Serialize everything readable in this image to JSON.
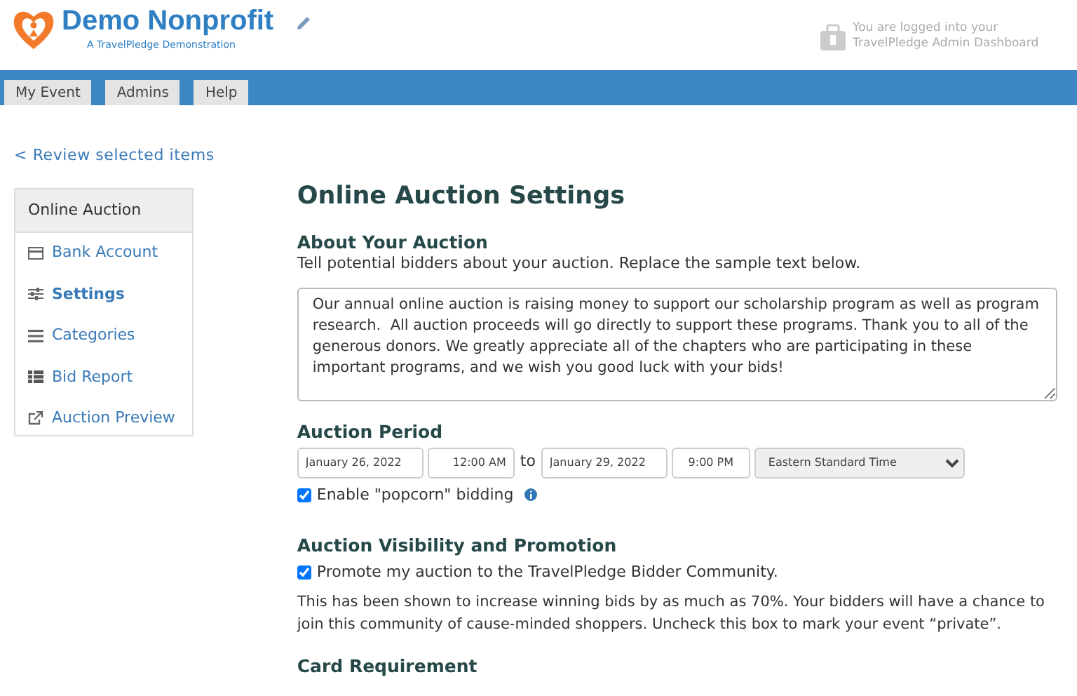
{
  "header": {
    "logo_title": "Demo Nonprofit",
    "logo_subtitle": "A TravelPledge Demonstration",
    "login_note": "You are logged into your TravelPledge Admin Dashboard"
  },
  "tabs": [
    {
      "label": "My Event"
    },
    {
      "label": "Admins"
    },
    {
      "label": "Help"
    }
  ],
  "back_link": "< Review selected items",
  "sidebar": {
    "title": "Online Auction",
    "items": [
      {
        "label": "Bank Account",
        "selected": false
      },
      {
        "label": "Settings",
        "selected": true
      },
      {
        "label": "Categories",
        "selected": false
      },
      {
        "label": "Bid Report",
        "selected": false
      },
      {
        "label": "Auction Preview",
        "selected": false
      }
    ]
  },
  "page_title": "Online Auction Settings",
  "about": {
    "heading": "About Your Auction",
    "hint": "Tell potential bidders about your auction. Replace the sample text below.",
    "text": "Our annual online auction is raising money to support our scholarship program as well as program research.  All auction proceeds will go directly to support these programs. Thank you to all of the generous donors. We greatly appreciate all of the chapters who are participating in these important programs, and we wish you good luck with your bids!"
  },
  "period": {
    "heading": "Auction Period",
    "start_date": "January 26, 2022",
    "start_time": "12:00 AM",
    "separator": "to",
    "end_date": "January 29, 2022",
    "end_time": "9:00 PM",
    "timezone": "Eastern Standard Time",
    "popcorn": {
      "label": "Enable \"popcorn\" bidding",
      "checked": true
    }
  },
  "visibility": {
    "heading": "Auction Visibility and Promotion",
    "promote": {
      "label": "Promote my auction to the TravelPledge Bidder Community.",
      "checked": true
    },
    "note": "This has been shown to increase winning bids by as much as 70%. Your bidders will have a chance to join this community of cause-minded shoppers. Uncheck this box to mark your event “private”."
  },
  "card_heading": "Card Requirement"
}
